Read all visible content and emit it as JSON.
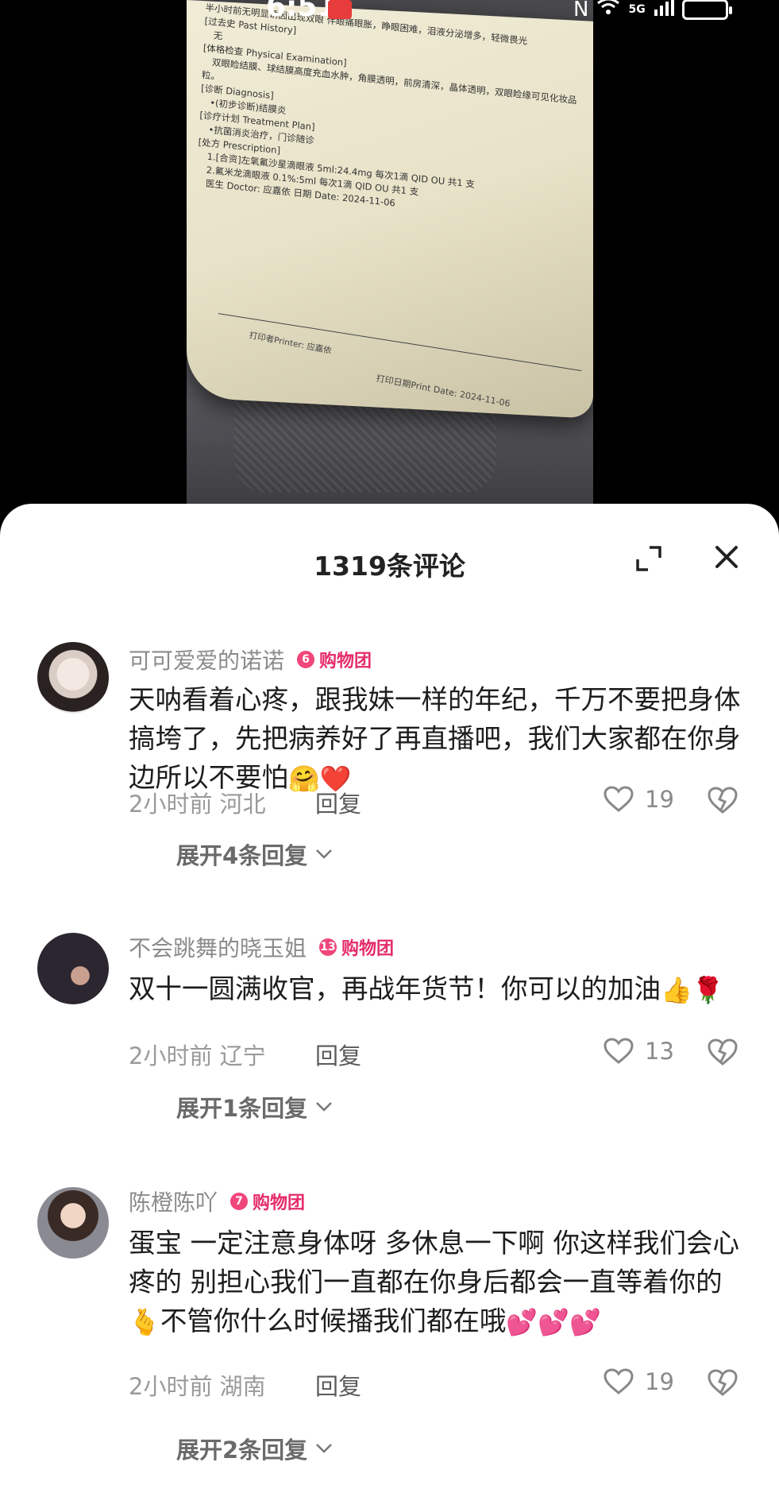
{
  "status_bar": {
    "time": "6:51",
    "network": "5G"
  },
  "document": {
    "lines": [
      "半小时前无明显诱因出现双眼   伴眼痛眼胀，睁眼困难，泪液分泌增多，轻微畏光",
      "[过去史 Past History]",
      "无",
      "[体格检查 Physical Examination]",
      "双眼睑结膜、球结膜高度充血水肿，角膜透明，前房清深，晶体透明，双眼睑缘可见化妆品",
      "粒。",
      "[诊断 Diagnosis]",
      "•(初步诊断)结膜炎",
      "[诊疗计划 Treatment Plan]",
      "•抗菌消炎治疗，门诊随诊",
      "[处方 Prescription]",
      "1.[合资]左氧氟沙星滴眼液 5ml:24.4mg     每次1滴     QID     OU     共1  支",
      "2.氟米龙滴眼液 0.1%:5ml          每次1滴     QID     OU     共1  支",
      "医生 Doctor: 应嘉依   日期 Date: 2024-11-06"
    ],
    "printer": "打印者Printer:        应嘉依",
    "print_date": "打印日期Print Date:    2024-11-06"
  },
  "sheet": {
    "title": "1319条评论"
  },
  "comments": [
    {
      "username": "可可爱爱的诺诺",
      "badge_level": "6",
      "badge_text": "购物团",
      "text": "天呐看着心疼，跟我妹一样的年纪，千万不要把身体搞垮了，先把病养好了再直播吧，我们大家都在你身边所以不要怕",
      "emojis": "🤗❤️",
      "time": "2小时前",
      "location": "河北",
      "reply_label": "回复",
      "likes": "19",
      "expand_label": "展开4条回复"
    },
    {
      "username": "不会跳舞的晓玉姐",
      "badge_level": "13",
      "badge_text": "购物团",
      "text": "双十一圆满收官，再战年货节！你可以的加油",
      "emojis": "👍🌹",
      "time": "2小时前",
      "location": "辽宁",
      "reply_label": "回复",
      "likes": "13",
      "expand_label": "展开1条回复"
    },
    {
      "username": "陈橙陈吖",
      "badge_level": "7",
      "badge_text": "购物团",
      "text": "蛋宝 一定注意身体呀 多休息一下啊 你这样我们会心疼的 别担心我们一直都在你身后都会一直等着你的",
      "text_mid_emoji": "🫰",
      "text_tail": "不管你什么时候播我们都在哦",
      "emojis": "💕💕💕",
      "time": "2小时前",
      "location": "湖南",
      "reply_label": "回复",
      "likes": "19",
      "expand_label": "展开2条回复"
    }
  ],
  "colors": {
    "badge": "#e52b6a",
    "sheet_bg": "#ffffff",
    "text": "#1d1d1d"
  }
}
